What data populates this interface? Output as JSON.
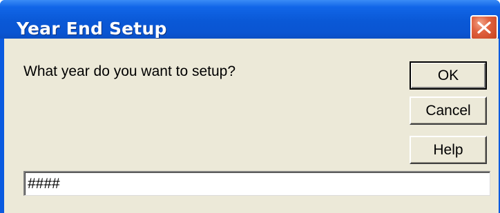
{
  "window": {
    "title": "Year End Setup",
    "close_icon": "close-icon",
    "titlebar_color": "#0a5ae0",
    "body_color": "#ece9d8"
  },
  "dialog": {
    "prompt": "What year do you want to setup?",
    "input_value": "####"
  },
  "buttons": {
    "ok_label": "OK",
    "cancel_label": "Cancel",
    "help_label": "Help"
  }
}
